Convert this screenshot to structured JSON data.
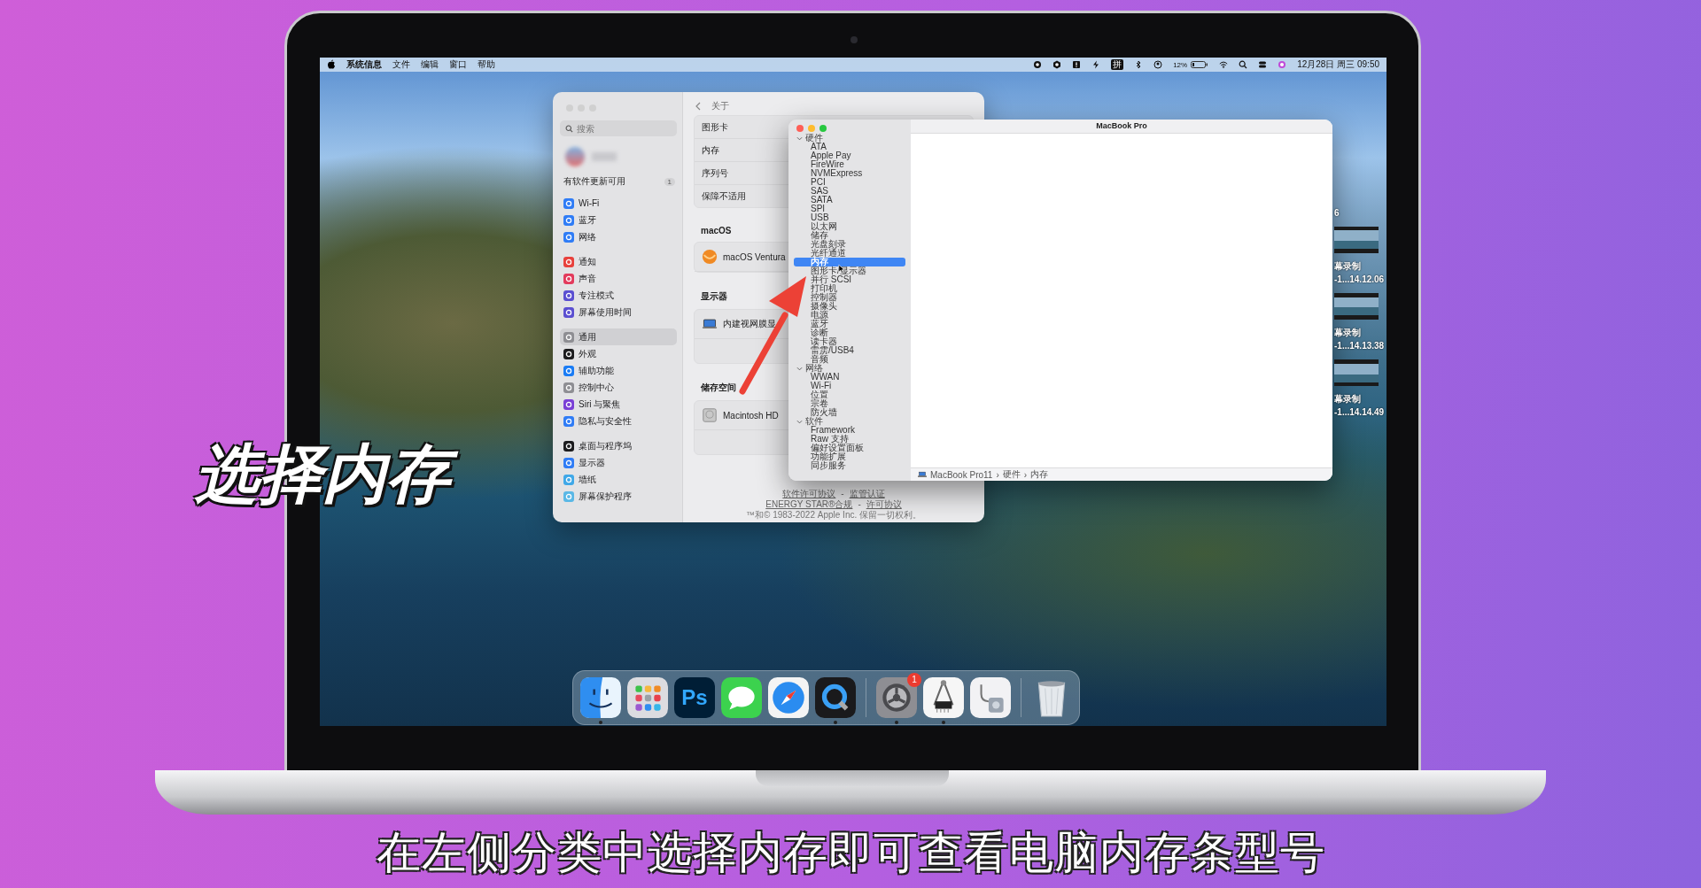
{
  "step_title": "选择内存",
  "menu_bar": {
    "app_name": "系统信息",
    "menus": [
      "文件",
      "编辑",
      "窗口",
      "帮助"
    ],
    "input_method": "拼",
    "battery_percent": "12%",
    "datetime": "12月28日 周三 09:50"
  },
  "settings": {
    "search_placeholder": "搜索",
    "update_notice": "有软件更新可用",
    "update_count": "1",
    "sidebar_groups": [
      {
        "items": [
          {
            "label": "Wi-Fi",
            "color": "#2f7cf6",
            "selected": false
          },
          {
            "label": "蓝牙",
            "color": "#2f7cf6",
            "selected": false
          },
          {
            "label": "网络",
            "color": "#2f7cf6",
            "selected": false
          }
        ]
      },
      {
        "items": [
          {
            "label": "通知",
            "color": "#e8413c",
            "selected": false
          },
          {
            "label": "声音",
            "color": "#e33b5c",
            "selected": false
          },
          {
            "label": "专注模式",
            "color": "#5b4fd1",
            "selected": false
          },
          {
            "label": "屏幕使用时间",
            "color": "#5b4fd1",
            "selected": false
          }
        ]
      },
      {
        "items": [
          {
            "label": "通用",
            "color": "#8e8e93",
            "selected": true
          },
          {
            "label": "外观",
            "color": "#1c1c1e",
            "selected": false
          },
          {
            "label": "辅助功能",
            "color": "#1a7cf5",
            "selected": false
          },
          {
            "label": "控制中心",
            "color": "#8e8e93",
            "selected": false
          },
          {
            "label": "Siri 与聚焦",
            "color": "#7a3fd6",
            "selected": false
          },
          {
            "label": "隐私与安全性",
            "color": "#2f7cf6",
            "selected": false
          }
        ]
      },
      {
        "items": [
          {
            "label": "桌面与程序坞",
            "color": "#1c1c1e",
            "selected": false
          },
          {
            "label": "显示器",
            "color": "#2f7cf6",
            "selected": false
          },
          {
            "label": "墙纸",
            "color": "#3fa8e8",
            "selected": false
          },
          {
            "label": "屏幕保护程序",
            "color": "#5ab8e6",
            "selected": false
          }
        ]
      }
    ],
    "page_title": "关于",
    "info_rows": [
      "图形卡",
      "内存",
      "序列号",
      "保障不适用"
    ],
    "sections": [
      {
        "heading": "macOS",
        "kind": "os",
        "item": "macOS Ventura"
      },
      {
        "heading": "显示器",
        "kind": "display",
        "item": "内建视网膜显"
      },
      {
        "heading": "储存空间",
        "kind": "disk",
        "item": "Macintosh HD"
      }
    ],
    "footer_lines": [
      {
        "links": [
          "软件许可协议",
          "监管认证"
        ]
      },
      {
        "links": [
          "ENERGY STAR®合规",
          "许可协议"
        ]
      }
    ],
    "footer_separator": "-",
    "copyright": "™和© 1983-2022 Apple Inc. 保留一切权利。"
  },
  "system_info": {
    "title": "MacBook Pro",
    "tree": [
      {
        "label": "硬件",
        "expanded": true,
        "children": [
          {
            "label": "ATA",
            "selected": false
          },
          {
            "label": "Apple Pay",
            "selected": false
          },
          {
            "label": "FireWire",
            "selected": false
          },
          {
            "label": "NVMExpress",
            "selected": false
          },
          {
            "label": "PCI",
            "selected": false
          },
          {
            "label": "SAS",
            "selected": false
          },
          {
            "label": "SATA",
            "selected": false
          },
          {
            "label": "SPI",
            "selected": false
          },
          {
            "label": "USB",
            "selected": false
          },
          {
            "label": "以太网",
            "selected": false
          },
          {
            "label": "储存",
            "selected": false
          },
          {
            "label": "光盘刻录",
            "selected": false
          },
          {
            "label": "光纤通道",
            "selected": false
          },
          {
            "label": "内存",
            "selected": true
          },
          {
            "label": "图形卡/显示器",
            "selected": false
          },
          {
            "label": "并行 SCSI",
            "selected": false
          },
          {
            "label": "打印机",
            "selected": false
          },
          {
            "label": "控制器",
            "selected": false
          },
          {
            "label": "摄像头",
            "selected": false
          },
          {
            "label": "电源",
            "selected": false
          },
          {
            "label": "蓝牙",
            "selected": false
          },
          {
            "label": "诊断",
            "selected": false
          },
          {
            "label": "读卡器",
            "selected": false
          },
          {
            "label": "雷雳/USB4",
            "selected": false
          },
          {
            "label": "音频",
            "selected": false
          }
        ]
      },
      {
        "label": "网络",
        "expanded": true,
        "children": [
          {
            "label": "WWAN",
            "selected": false
          },
          {
            "label": "Wi-Fi",
            "selected": false
          },
          {
            "label": "位置",
            "selected": false
          },
          {
            "label": "宗卷",
            "selected": false
          },
          {
            "label": "防火墙",
            "selected": false
          }
        ]
      },
      {
        "label": "软件",
        "expanded": true,
        "children": [
          {
            "label": "Framework",
            "selected": false
          },
          {
            "label": "Raw 支持",
            "selected": false
          },
          {
            "label": "偏好设置面板",
            "selected": false
          },
          {
            "label": "功能扩展",
            "selected": false
          },
          {
            "label": "同步服务",
            "selected": false
          }
        ]
      }
    ],
    "path": [
      "MacBook Pro11",
      "硬件",
      "内存"
    ],
    "path_separator": "›"
  },
  "desktop": {
    "cut_label": "6",
    "files": [
      {
        "line1": "幕录制",
        "line2": "-1...14.12.06"
      },
      {
        "line1": "幕录制",
        "line2": "-1...14.13.38"
      },
      {
        "line1": "幕录制",
        "line2": "-1...14.14.49"
      }
    ]
  },
  "dock": {
    "items": [
      {
        "kind": "finder",
        "running": true
      },
      {
        "kind": "launchpad",
        "running": false
      },
      {
        "kind": "photoshop",
        "label": "Ps",
        "running": false
      },
      {
        "kind": "messages",
        "running": false
      },
      {
        "kind": "safari",
        "running": false
      },
      {
        "kind": "quicktime",
        "running": true
      },
      {
        "kind": "separator"
      },
      {
        "kind": "settings",
        "badge": "1",
        "running": true
      },
      {
        "kind": "sysinfo",
        "running": true
      },
      {
        "kind": "diskutility",
        "running": false
      },
      {
        "kind": "separator"
      },
      {
        "kind": "trash",
        "running": false
      }
    ]
  },
  "subtitle": "在左侧分类中选择内存即可查看电脑内存条型号"
}
